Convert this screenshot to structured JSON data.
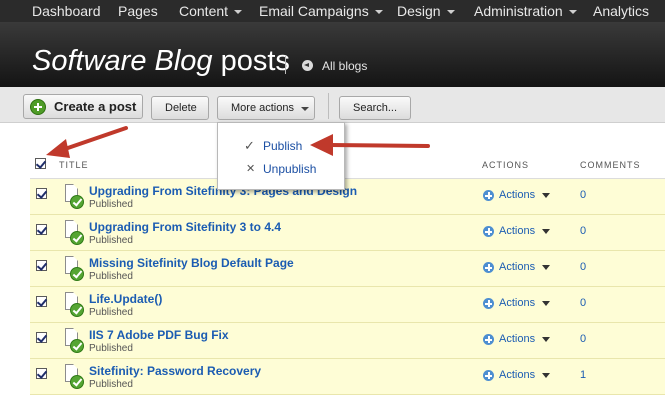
{
  "topnav": {
    "items": [
      "Dashboard",
      "Pages",
      "Content",
      "Email Campaigns",
      "Design",
      "Administration",
      "Analytics"
    ]
  },
  "header": {
    "title_italic": "Software Blog",
    "title_rest": " posts",
    "back_link": "All blogs"
  },
  "toolbar": {
    "create_label": "Create a post",
    "delete_label": "Delete",
    "more_label": "More actions",
    "search_label": "Search..."
  },
  "more_actions_menu": {
    "items": [
      {
        "label": "Publish",
        "icon": "check-icon",
        "selected": true
      },
      {
        "label": "Unpublish",
        "icon": "x-icon",
        "selected": false
      }
    ]
  },
  "grid": {
    "columns": [
      "TITLE",
      "ACTIONS",
      "COMMENTS"
    ],
    "select_all_checked": true,
    "rows": [
      {
        "title": "Upgrading From Sitefinity 3: Pages and Design",
        "status": "Published",
        "actions": "Actions",
        "comments": "0",
        "checked": true
      },
      {
        "title": "Upgrading From Sitefinity 3 to 4.4",
        "status": "Published",
        "actions": "Actions",
        "comments": "0",
        "checked": true
      },
      {
        "title": "Missing Sitefinity Blog Default Page",
        "status": "Published",
        "actions": "Actions",
        "comments": "0",
        "checked": true
      },
      {
        "title": "Life.Update()",
        "status": "Published",
        "actions": "Actions",
        "comments": "0",
        "checked": true
      },
      {
        "title": "IIS 7 Adobe PDF Bug Fix",
        "status": "Published",
        "actions": "Actions",
        "comments": "0",
        "checked": true
      },
      {
        "title": "Sitefinity: Password Recovery",
        "status": "Published",
        "actions": "Actions",
        "comments": "1",
        "checked": true
      }
    ]
  },
  "colors": {
    "nav_bg": "#2b2b2b",
    "link_blue": "#1b5cb2",
    "row_highlight": "#fefdd6",
    "annotation_arrow": "#c0392b",
    "published_green": "#55a533"
  }
}
